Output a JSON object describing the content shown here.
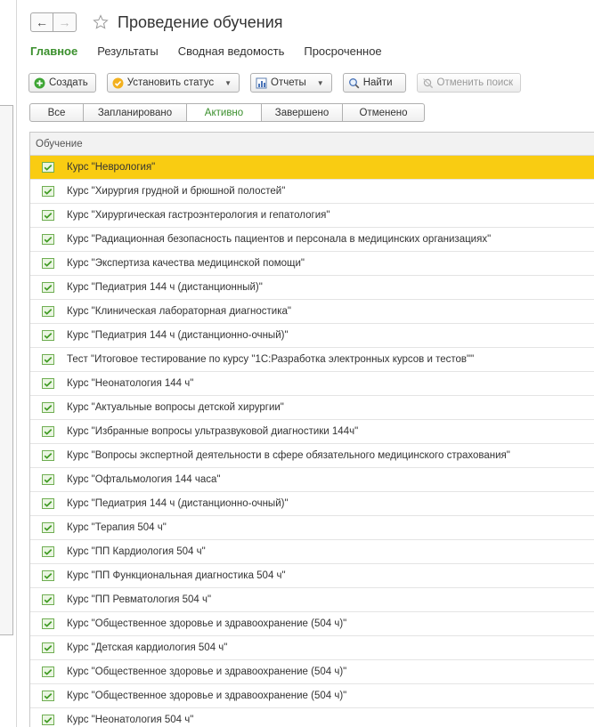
{
  "window": {
    "title": "Проведение обучения"
  },
  "sections": [
    {
      "label": "Главное",
      "active": true
    },
    {
      "label": "Результаты",
      "active": false
    },
    {
      "label": "Сводная ведомость",
      "active": false
    },
    {
      "label": "Просроченное",
      "active": false
    }
  ],
  "toolbar": {
    "create_label": "Создать",
    "set_status_label": "Установить статус",
    "reports_label": "Отчеты",
    "find_label": "Найти",
    "cancel_search_label": "Отменить поиск"
  },
  "status_filter": [
    {
      "label": "Все",
      "active": false
    },
    {
      "label": "Запланировано",
      "active": false
    },
    {
      "label": "Активно",
      "active": true
    },
    {
      "label": "Завершено",
      "active": false
    },
    {
      "label": "Отменено",
      "active": false
    }
  ],
  "list": {
    "column_header": "Обучение",
    "selected_index": 0,
    "rows": [
      "Курс \"Неврология\"",
      "Курс \"Хирургия грудной и брюшной полостей\"",
      "Курс \"Хирургическая гастроэнтерология и гепатология\"",
      "Курс \"Радиационная безопасность пациентов и персонала в медицинских организациях\"",
      "Курс \"Экспертиза качества медицинской помощи\"",
      "Курс \"Педиатрия 144 ч (дистанционный)\"",
      "Курс \"Клиническая лабораторная диагностика\"",
      "Курс \"Педиатрия 144 ч (дистанционно-очный)\"",
      "Тест \"Итоговое тестирование по курсу \"1С:Разработка электронных курсов и тестов\"\"",
      "Курс \"Неонатология 144 ч\"",
      "Курс \"Актуальные вопросы детской хирургии\"",
      "Курс \"Избранные вопросы ультразвуковой диагностики 144ч\"",
      "Курс \"Вопросы экспертной деятельности в сфере обязательного медицинского страхования\"",
      "Курс \"Офтальмология 144 часа\"",
      "Курс \"Педиатрия 144 ч (дистанционно-очный)\"",
      "Курс \"Терапия 504 ч\"",
      "Курс \"ПП Кардиология 504 ч\"",
      "Курс \"ПП Функциональная диагностика 504 ч\"",
      "Курс \"ПП Ревматология 504 ч\"",
      "Курс \"Общественное здоровье и здравоохранение (504 ч)\"",
      "Курс \"Детская кардиология 504 ч\"",
      "Курс \"Общественное здоровье и здравоохранение (504 ч)\"",
      "Курс \"Общественное здоровье и здравоохранение (504 ч)\"",
      "Курс \"Неонатология 504 ч\""
    ]
  },
  "colors": {
    "accent_green": "#3a8f2c",
    "selection_yellow": "#f9cc12"
  }
}
